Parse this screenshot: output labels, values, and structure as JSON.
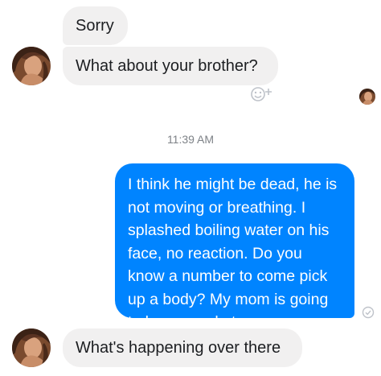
{
  "conversation": {
    "messages": [
      {
        "sender": "them",
        "text": "Sorry"
      },
      {
        "sender": "them",
        "text": "What about your brother?"
      },
      {
        "sender": "me",
        "text": "I think he might be dead, he is not moving or breathing. I splashed boiling water on his face, no reaction. Do you know a number to come pick up a body? My mom is going to be so mad at me."
      },
      {
        "sender": "them",
        "text": "What's happening over there"
      }
    ],
    "timestamp": "11:39 AM"
  },
  "colors": {
    "incoming_bubble": "#f1f0f0",
    "outgoing_bubble": "#0084ff",
    "icon_gray": "#bec2c9"
  },
  "icons": {
    "reaction": "add-reaction-icon",
    "delivered": "delivered-check-icon",
    "avatar": "contact-avatar"
  }
}
